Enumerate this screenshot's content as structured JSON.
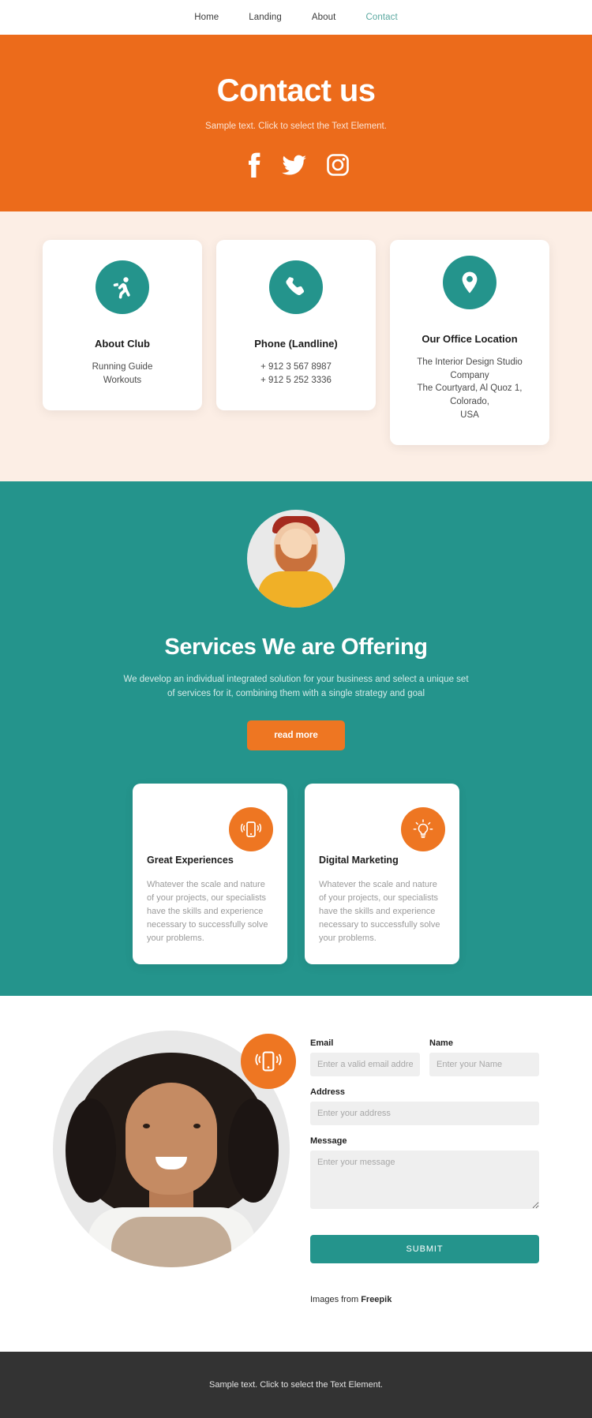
{
  "nav": {
    "items": [
      {
        "label": "Home",
        "active": false
      },
      {
        "label": "Landing",
        "active": false
      },
      {
        "label": "About",
        "active": false
      },
      {
        "label": "Contact",
        "active": true
      }
    ]
  },
  "hero": {
    "title": "Contact us",
    "subtitle": "Sample text. Click to select the Text Element.",
    "socials": [
      {
        "name": "facebook-icon"
      },
      {
        "name": "twitter-icon"
      },
      {
        "name": "instagram-icon"
      }
    ]
  },
  "info_cards": [
    {
      "icon": "running-icon",
      "title": "About Club",
      "lines": [
        "Running Guide",
        "Workouts"
      ]
    },
    {
      "icon": "phone-icon",
      "title": "Phone (Landline)",
      "lines": [
        "+ 912 3 567 8987",
        "+ 912 5 252 3336"
      ]
    },
    {
      "icon": "location-pin-icon",
      "title": "Our Office Location",
      "lines": [
        "The Interior Design Studio Company",
        "The Courtyard, Al Quoz 1, Colorado,",
        "USA"
      ]
    }
  ],
  "services": {
    "title": "Services We are Offering",
    "description": "We develop an individual integrated solution for your business and select a unique set of services for it, combining them with a single strategy and goal",
    "button": "read more",
    "cards": [
      {
        "icon": "mobile-vibrate-icon",
        "title": "Great Experiences",
        "text": "Whatever the scale and nature of your projects, our specialists have the skills and experience necessary to successfully solve your problems."
      },
      {
        "icon": "lightbulb-icon",
        "title": "Digital Marketing",
        "text": "Whatever the scale and nature of your projects, our specialists have the skills and experience necessary to successfully solve your problems."
      }
    ]
  },
  "contact_form": {
    "badge_icon": "mobile-vibrate-icon",
    "email": {
      "label": "Email",
      "placeholder": "Enter a valid email address",
      "value": ""
    },
    "name": {
      "label": "Name",
      "placeholder": "Enter your Name",
      "value": ""
    },
    "address": {
      "label": "Address",
      "placeholder": "Enter your address",
      "value": ""
    },
    "message": {
      "label": "Message",
      "placeholder": "Enter your message",
      "value": ""
    },
    "submit": "SUBMIT",
    "credit_prefix": "Images from ",
    "credit_brand": "Freepik"
  },
  "footer": {
    "text": "Sample text. Click to select the Text Element."
  },
  "colors": {
    "orange": "#ec6b1b",
    "teal": "#24948c",
    "cream": "#fceee5",
    "footer_dark": "#333333",
    "nav_active": "#5aa8a0"
  }
}
